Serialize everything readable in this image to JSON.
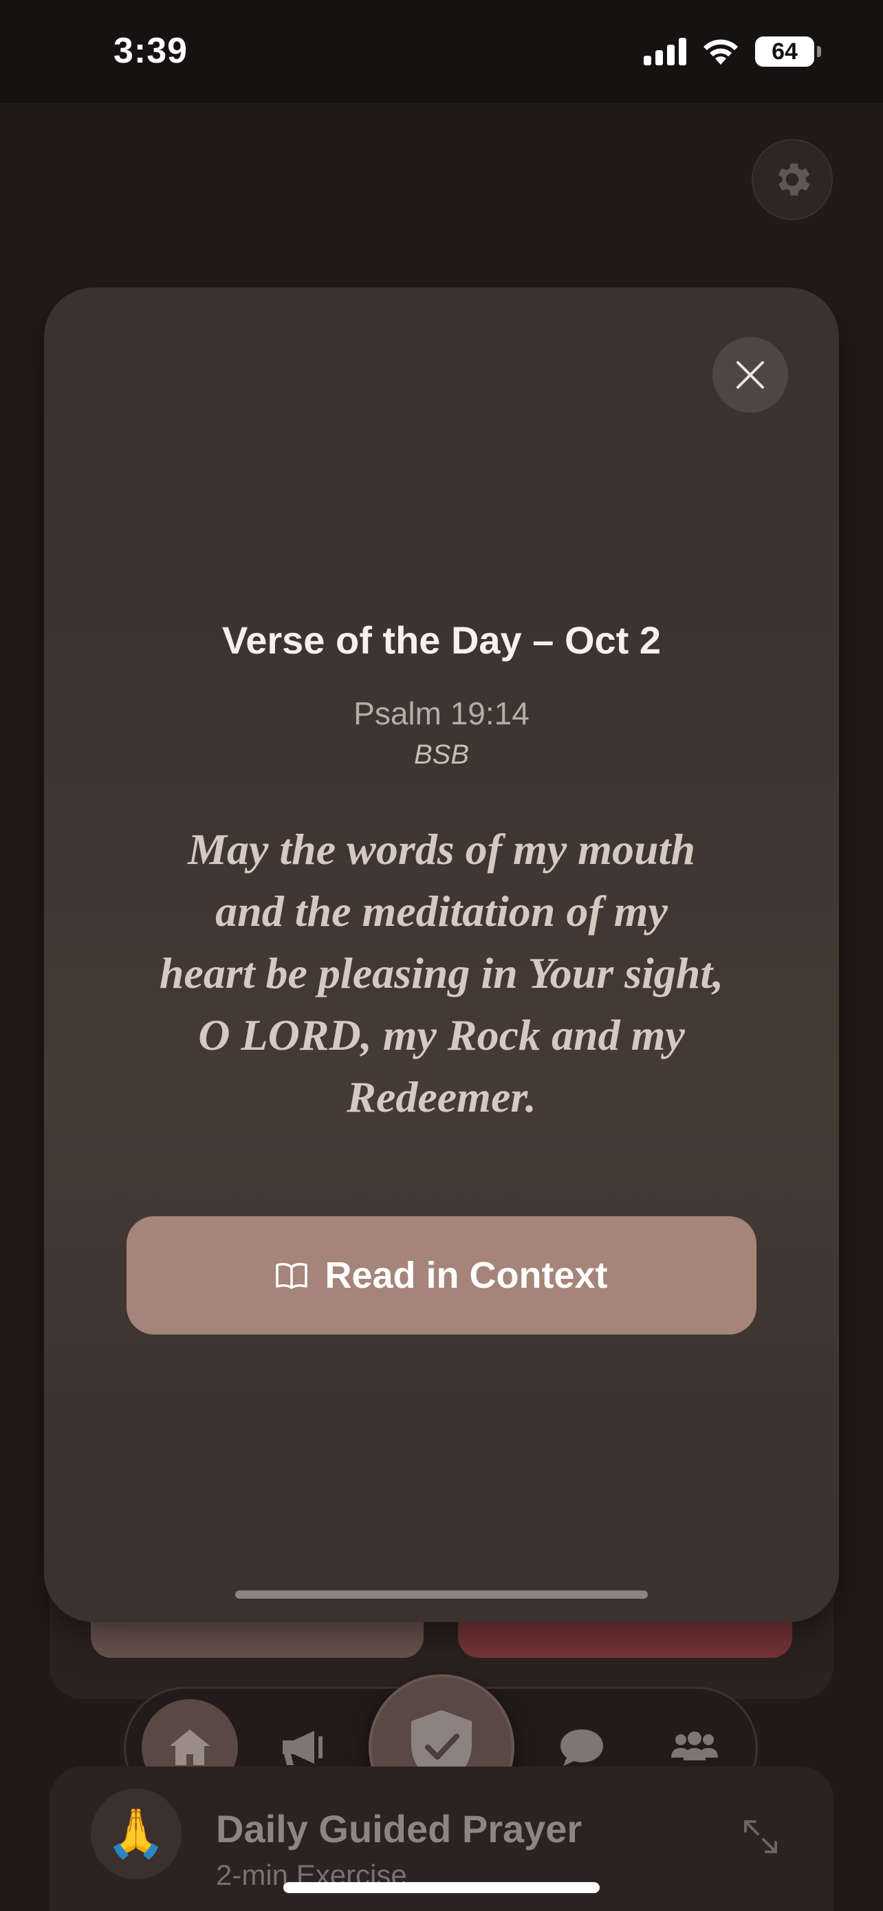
{
  "status_bar": {
    "time": "3:39",
    "battery": "64"
  },
  "modal": {
    "title": "Verse of the Day – Oct 2",
    "reference": "Psalm 19:14",
    "translation": "BSB",
    "verse_lines": [
      "May the words of my mouth",
      "and the meditation of my",
      "heart be pleasing in Your sight,",
      "O LORD, my Rock and my",
      "Redeemer."
    ],
    "read_button_label": "Read in Context",
    "read_button_icon": "book-icon",
    "close_icon": "close-icon"
  },
  "settings": {
    "icon": "gear-icon"
  },
  "tabbar": {
    "tabs": [
      {
        "icon": "home-icon",
        "active": true
      },
      {
        "icon": "megaphone-icon",
        "active": false
      },
      {
        "icon": "shield-check-icon",
        "active": false
      },
      {
        "icon": "chat-bubble-icon",
        "active": false
      },
      {
        "icon": "people-icon",
        "active": false
      }
    ]
  },
  "prayer_card": {
    "title": "Daily Guided Prayer",
    "subtitle": "2-min Exercise",
    "emoji": "🙏",
    "expand_icon": "expand-icon"
  },
  "colors": {
    "accent": "#a58479",
    "danger_button": "#7a3639",
    "background": "#211a18"
  }
}
